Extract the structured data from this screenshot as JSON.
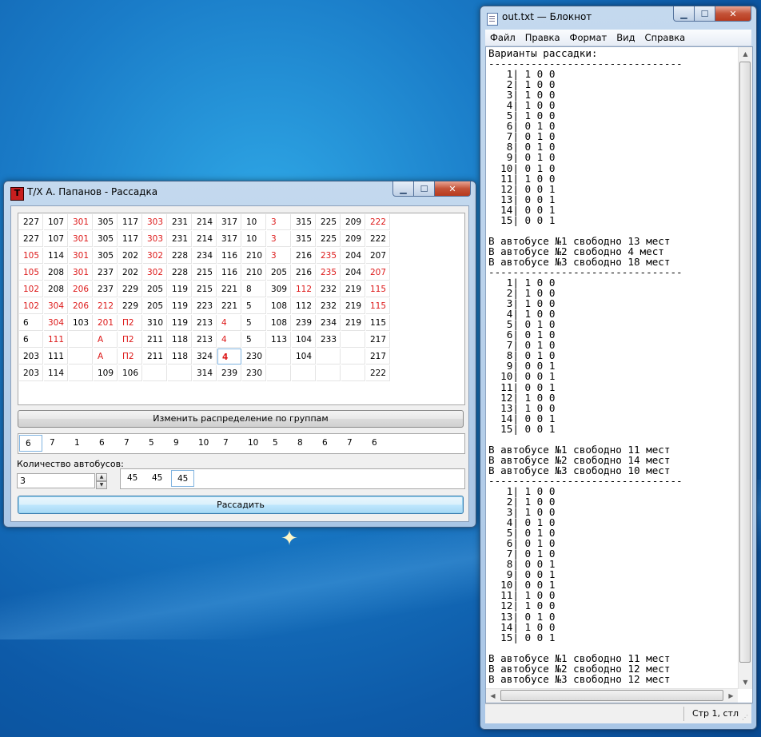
{
  "app": {
    "title": "Т/Х А. Папанов - Рассадка",
    "icon_letter": "Т",
    "grid_rows": [
      [
        {
          "v": "227",
          "r": false
        },
        {
          "v": "107",
          "r": false
        },
        {
          "v": "301",
          "r": true
        },
        {
          "v": "305",
          "r": false
        },
        {
          "v": "117",
          "r": false
        },
        {
          "v": "303",
          "r": true
        },
        {
          "v": "231",
          "r": false
        },
        {
          "v": "214",
          "r": false
        },
        {
          "v": "317",
          "r": false
        },
        {
          "v": "10",
          "r": false
        },
        {
          "v": "3",
          "r": true
        },
        {
          "v": "315",
          "r": false
        },
        {
          "v": "225",
          "r": false
        },
        {
          "v": "209",
          "r": false
        },
        {
          "v": "222",
          "r": true
        }
      ],
      [
        {
          "v": "227",
          "r": false
        },
        {
          "v": "107",
          "r": false
        },
        {
          "v": "301",
          "r": true
        },
        {
          "v": "305",
          "r": false
        },
        {
          "v": "117",
          "r": false
        },
        {
          "v": "303",
          "r": true
        },
        {
          "v": "231",
          "r": false
        },
        {
          "v": "214",
          "r": false
        },
        {
          "v": "317",
          "r": false
        },
        {
          "v": "10",
          "r": false
        },
        {
          "v": "3",
          "r": true
        },
        {
          "v": "315",
          "r": false
        },
        {
          "v": "225",
          "r": false
        },
        {
          "v": "209",
          "r": false
        },
        {
          "v": "222",
          "r": false
        }
      ],
      [
        {
          "v": "105",
          "r": true
        },
        {
          "v": "114",
          "r": false
        },
        {
          "v": "301",
          "r": true
        },
        {
          "v": "305",
          "r": false
        },
        {
          "v": "202",
          "r": false
        },
        {
          "v": "302",
          "r": true
        },
        {
          "v": "228",
          "r": false
        },
        {
          "v": "234",
          "r": false
        },
        {
          "v": "116",
          "r": false
        },
        {
          "v": "210",
          "r": false
        },
        {
          "v": "3",
          "r": true
        },
        {
          "v": "216",
          "r": false
        },
        {
          "v": "235",
          "r": true
        },
        {
          "v": "204",
          "r": false
        },
        {
          "v": "207",
          "r": false
        }
      ],
      [
        {
          "v": "105",
          "r": true
        },
        {
          "v": "208",
          "r": false
        },
        {
          "v": "301",
          "r": true
        },
        {
          "v": "237",
          "r": false
        },
        {
          "v": "202",
          "r": false
        },
        {
          "v": "302",
          "r": true
        },
        {
          "v": "228",
          "r": false
        },
        {
          "v": "215",
          "r": false
        },
        {
          "v": "116",
          "r": false
        },
        {
          "v": "210",
          "r": false
        },
        {
          "v": "205",
          "r": false
        },
        {
          "v": "216",
          "r": false
        },
        {
          "v": "235",
          "r": true
        },
        {
          "v": "204",
          "r": false
        },
        {
          "v": "207",
          "r": true
        }
      ],
      [
        {
          "v": "102",
          "r": true
        },
        {
          "v": "208",
          "r": false
        },
        {
          "v": "206",
          "r": true
        },
        {
          "v": "237",
          "r": false
        },
        {
          "v": "229",
          "r": false
        },
        {
          "v": "205",
          "r": false
        },
        {
          "v": "119",
          "r": false
        },
        {
          "v": "215",
          "r": false
        },
        {
          "v": "221",
          "r": false
        },
        {
          "v": "8",
          "r": false
        },
        {
          "v": "309",
          "r": false
        },
        {
          "v": "112",
          "r": true
        },
        {
          "v": "232",
          "r": false
        },
        {
          "v": "219",
          "r": false
        },
        {
          "v": "115",
          "r": true
        }
      ],
      [
        {
          "v": "102",
          "r": true
        },
        {
          "v": "304",
          "r": true
        },
        {
          "v": "206",
          "r": true
        },
        {
          "v": "212",
          "r": true
        },
        {
          "v": "229",
          "r": false
        },
        {
          "v": "205",
          "r": false
        },
        {
          "v": "119",
          "r": false
        },
        {
          "v": "223",
          "r": false
        },
        {
          "v": "221",
          "r": false
        },
        {
          "v": "5",
          "r": false
        },
        {
          "v": "108",
          "r": false
        },
        {
          "v": "112",
          "r": false
        },
        {
          "v": "232",
          "r": false
        },
        {
          "v": "219",
          "r": false
        },
        {
          "v": "115",
          "r": true
        }
      ],
      [
        {
          "v": "6",
          "r": false
        },
        {
          "v": "304",
          "r": true
        },
        {
          "v": "103",
          "r": false
        },
        {
          "v": "201",
          "r": true
        },
        {
          "v": "П2",
          "r": true
        },
        {
          "v": "310",
          "r": false
        },
        {
          "v": "119",
          "r": false
        },
        {
          "v": "213",
          "r": false
        },
        {
          "v": "4",
          "r": true
        },
        {
          "v": "5",
          "r": false
        },
        {
          "v": "108",
          "r": false
        },
        {
          "v": "239",
          "r": false
        },
        {
          "v": "234",
          "r": false
        },
        {
          "v": "219",
          "r": false
        },
        {
          "v": "115",
          "r": false
        }
      ],
      [
        {
          "v": "6",
          "r": false
        },
        {
          "v": "111",
          "r": true
        },
        {
          "v": "",
          "r": false
        },
        {
          "v": "А",
          "r": true
        },
        {
          "v": "П2",
          "r": true
        },
        {
          "v": "211",
          "r": false
        },
        {
          "v": "118",
          "r": false
        },
        {
          "v": "213",
          "r": false
        },
        {
          "v": "4",
          "r": true
        },
        {
          "v": "5",
          "r": false
        },
        {
          "v": "113",
          "r": false
        },
        {
          "v": "104",
          "r": false
        },
        {
          "v": "233",
          "r": false
        },
        {
          "v": "",
          "r": false
        },
        {
          "v": "217",
          "r": false
        }
      ],
      [
        {
          "v": "203",
          "r": false
        },
        {
          "v": "111",
          "r": false
        },
        {
          "v": "",
          "r": false
        },
        {
          "v": "А",
          "r": true
        },
        {
          "v": "П2",
          "r": true
        },
        {
          "v": "211",
          "r": false
        },
        {
          "v": "118",
          "r": false
        },
        {
          "v": "324",
          "r": false
        },
        {
          "v": "4",
          "r": true
        },
        {
          "v": "230",
          "r": false
        },
        {
          "v": "",
          "r": false
        },
        {
          "v": "104",
          "r": false
        },
        {
          "v": "",
          "r": false
        },
        {
          "v": "",
          "r": false
        },
        {
          "v": "217",
          "r": false
        }
      ],
      [
        {
          "v": "203",
          "r": false
        },
        {
          "v": "114",
          "r": false
        },
        {
          "v": "",
          "r": false
        },
        {
          "v": "109",
          "r": false
        },
        {
          "v": "106",
          "r": false
        },
        {
          "v": "",
          "r": false
        },
        {
          "v": "",
          "r": false
        },
        {
          "v": "314",
          "r": false
        },
        {
          "v": "239",
          "r": false
        },
        {
          "v": "230",
          "r": false
        },
        {
          "v": "",
          "r": false
        },
        {
          "v": "",
          "r": false
        },
        {
          "v": "",
          "r": false
        },
        {
          "v": "",
          "r": false
        },
        {
          "v": "222",
          "r": false
        }
      ]
    ],
    "change_groups_label": "Изменить распределение по группам",
    "groups": [
      "6",
      "7",
      "1",
      "6",
      "7",
      "5",
      "9",
      "10",
      "7",
      "10",
      "5",
      "8",
      "6",
      "7",
      "6"
    ],
    "bus_count_label": "Количество автобусов:",
    "bus_count_value": "3",
    "capacities": [
      "45",
      "45",
      "45"
    ],
    "seat_button_label": "Рассадить"
  },
  "notepad": {
    "title": "out.txt — Блокнот",
    "menu": [
      "Файл",
      "Правка",
      "Формат",
      "Вид",
      "Справка"
    ],
    "content": "Варианты рассадки:\n--------------------------------\n   1| 1 0 0\n   2| 1 0 0\n   3| 1 0 0\n   4| 1 0 0\n   5| 1 0 0\n   6| 0 1 0\n   7| 0 1 0\n   8| 0 1 0\n   9| 0 1 0\n  10| 0 1 0\n  11| 1 0 0\n  12| 0 0 1\n  13| 0 0 1\n  14| 0 0 1\n  15| 0 0 1\n\nВ автобусе №1 свободно 13 мест\nВ автобусе №2 свободно 4 мест\nВ автобусе №3 свободно 18 мест\n--------------------------------\n   1| 1 0 0\n   2| 1 0 0\n   3| 1 0 0\n   4| 1 0 0\n   5| 0 1 0\n   6| 0 1 0\n   7| 0 1 0\n   8| 0 1 0\n   9| 0 0 1\n  10| 0 0 1\n  11| 0 0 1\n  12| 1 0 0\n  13| 1 0 0\n  14| 0 0 1\n  15| 0 0 1\n\nВ автобусе №1 свободно 11 мест\nВ автобусе №2 свободно 14 мест\nВ автобусе №3 свободно 10 мест\n--------------------------------\n   1| 1 0 0\n   2| 1 0 0\n   3| 1 0 0\n   4| 0 1 0\n   5| 0 1 0\n   6| 0 1 0\n   7| 0 1 0\n   8| 0 0 1\n   9| 0 0 1\n  10| 0 0 1\n  11| 1 0 0\n  12| 1 0 0\n  13| 0 1 0\n  14| 1 0 0\n  15| 0 0 1\n\nВ автобусе №1 свободно 11 мест\nВ автобусе №2 свободно 12 мест\nВ автобусе №3 свободно 12 мест",
    "status": "Стр 1, стл"
  },
  "colors": {
    "red_text": "#dd1a1a",
    "close_button": "#c45338"
  }
}
